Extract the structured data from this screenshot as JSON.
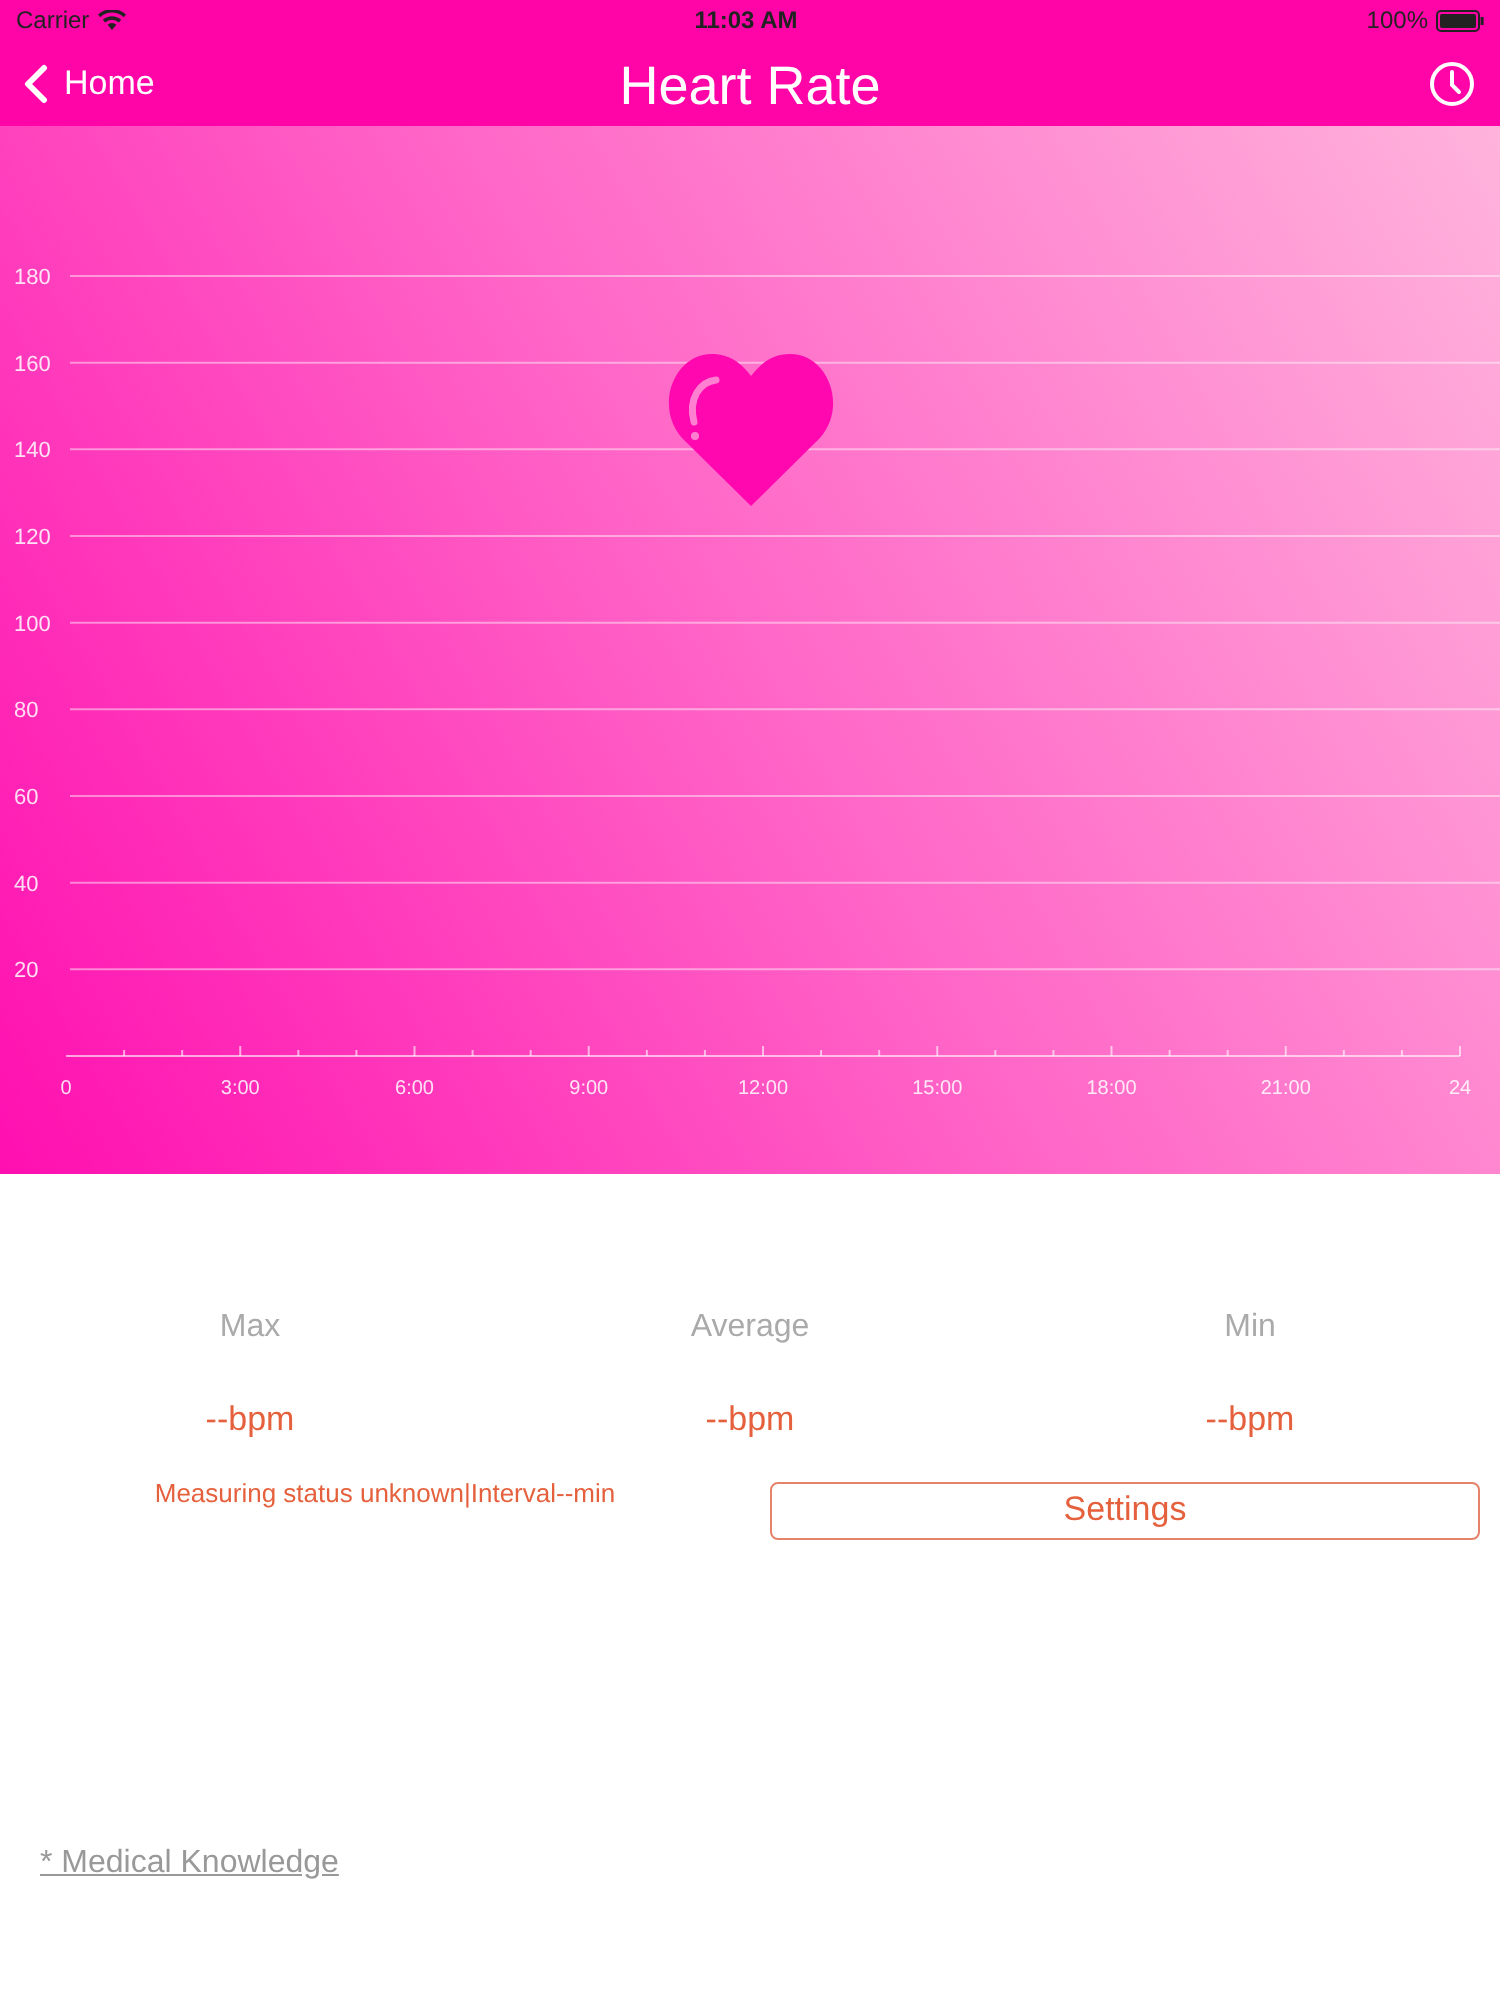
{
  "status_bar": {
    "carrier": "Carrier",
    "time": "11:03 AM",
    "battery": "100%"
  },
  "nav": {
    "back": "Home",
    "title": "Heart Rate"
  },
  "chart": {
    "chart_data": {
      "type": "line",
      "xlim": [
        0,
        24
      ],
      "ylim": [
        0,
        180
      ],
      "grid": true,
      "yticks": [
        20,
        40,
        60,
        80,
        100,
        120,
        140,
        160,
        180
      ],
      "xticks": [
        {
          "value": 0,
          "label": "0"
        },
        {
          "value": 3,
          "label": "3:00"
        },
        {
          "value": 6,
          "label": "6:00"
        },
        {
          "value": 9,
          "label": "9:00"
        },
        {
          "value": 12,
          "label": "12:00"
        },
        {
          "value": 15,
          "label": "15:00"
        },
        {
          "value": 18,
          "label": "18:00"
        },
        {
          "value": 21,
          "label": "21:00"
        },
        {
          "value": 24,
          "label": "24"
        }
      ]
    }
  },
  "stats": [
    {
      "label": "Max",
      "value": "--bpm"
    },
    {
      "label": "Average",
      "value": "--bpm"
    },
    {
      "label": "Min",
      "value": "--bpm"
    }
  ],
  "measuring_status": "Measuring status unknown|Interval--min",
  "settings_button": "Settings",
  "footer_link": "* Medical Knowledge"
}
